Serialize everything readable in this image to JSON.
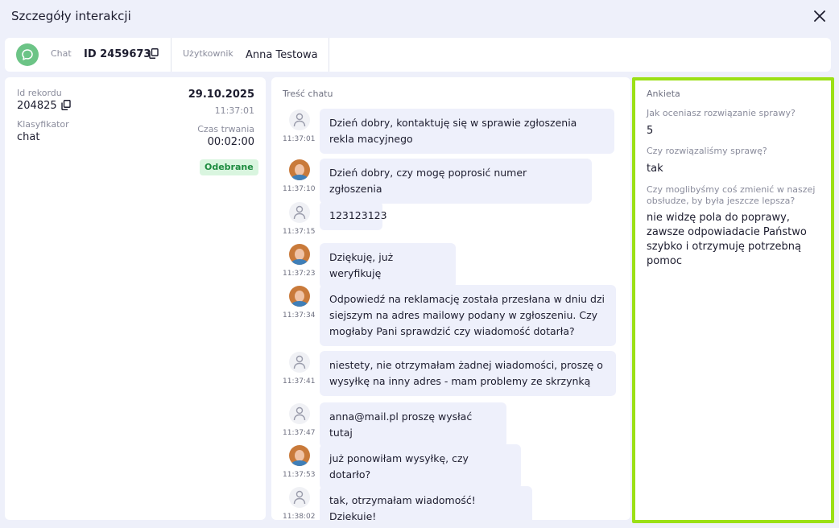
{
  "modal": {
    "title": "Szczegóły interakcji"
  },
  "infobar": {
    "channel_label": "Chat",
    "id_value": "ID 2459673",
    "user_label": "Użytkownik",
    "user_value": "Anna Testowa"
  },
  "record": {
    "id_label": "Id rekordu",
    "id_value": "204825",
    "classifier_label": "Klasyfikator",
    "classifier_value": "chat",
    "date": "29.10.2025",
    "time": "11:37:01",
    "duration_label": "Czas trwania",
    "duration_value": "00:02:00",
    "status": "Odebrane"
  },
  "chat": {
    "title": "Treść chatu",
    "messages": [
      {
        "sender": "user",
        "time": "11:37:01",
        "text": "Dzień dobry, kontaktuję się w sprawie zgłoszenia rekla macyjnego"
      },
      {
        "sender": "agent",
        "time": "11:37:10",
        "text": "Dzień dobry, czy mogę poprosić numer zgłoszenia"
      },
      {
        "sender": "user",
        "time": "11:37:15",
        "text": "123123123"
      },
      {
        "sender": "agent",
        "time": "11:37:23",
        "text": "Dziękuję, już weryfikuję"
      },
      {
        "sender": "agent",
        "time": "11:37:34",
        "text": "Odpowiedź na reklamację została przesłana w dniu dzi siejszym na adres mailowy podany w zgłoszeniu. Czy mogłaby Pani sprawdzić czy wiadomość dotarła?"
      },
      {
        "sender": "user",
        "time": "11:37:41",
        "text": "niestety, nie otrzymałam żadnej wiadomości, proszę o wysyłkę na inny adres - mam problemy ze skrzynką"
      },
      {
        "sender": "user",
        "time": "11:37:47",
        "text": "anna@mail.pl proszę wysłać tutaj"
      },
      {
        "sender": "agent",
        "time": "11:37:53",
        "text": "już ponowiłam wysyłkę, czy dotarło?"
      },
      {
        "sender": "user",
        "time": "11:38:02",
        "text": "tak, otrzymałam wiadomość! Dziękuję!"
      }
    ]
  },
  "survey": {
    "title": "Ankieta",
    "q1": "Jak oceniasz rozwiązanie sprawy?",
    "a1": "5",
    "q2": "Czy rozwiązaliśmy sprawę?",
    "a2": "tak",
    "q3": "Czy moglibyśmy coś zmienić w naszej obsłudze, by była jeszcze lepsza?",
    "a3": "nie widzę pola do poprawy, zawsze odpowiadacie Państwo szybko i otrzymuję potrzebną pomoc"
  },
  "colors": {
    "accent_highlight": "#9be016",
    "chat_badge": "#6cc486",
    "status_bg": "#d9f5df",
    "status_text": "#1d8b3f",
    "bubble_bg": "#eef0fb"
  },
  "icons": {
    "close": "close-icon",
    "chat": "chat-bubble-icon",
    "copy": "copy-icon",
    "user_avatar": "person-icon"
  }
}
